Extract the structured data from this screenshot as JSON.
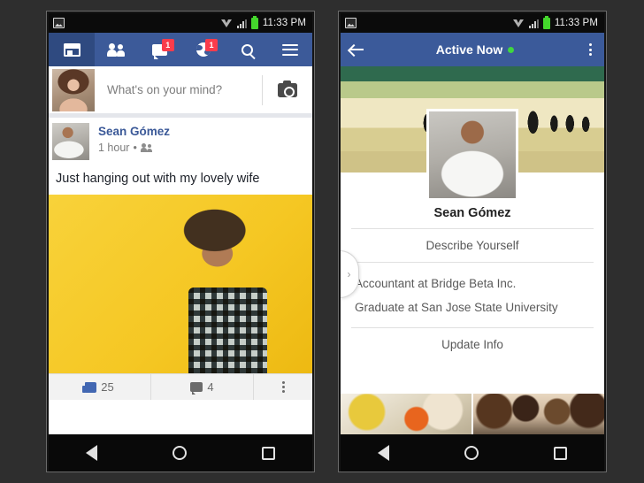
{
  "background_color": "#2e2e2e",
  "phones": {
    "left": {
      "status_bar": {
        "photo_icon": "photo-icon",
        "wifi_icon": "wifi-icon",
        "signal_icon": "signal-icon",
        "battery_icon": "battery-icon",
        "time": "11:33 PM"
      },
      "nav": {
        "accent_color": "#3c5a99",
        "active_color": "#2f4a80",
        "badge_color": "#fa3c4c",
        "tabs": [
          {
            "name": "news-feed",
            "icon": "news-feed-icon",
            "active": true,
            "badge": ""
          },
          {
            "name": "friend-requests",
            "icon": "friends-icon",
            "active": false,
            "badge": ""
          },
          {
            "name": "messages",
            "icon": "message-icon",
            "active": false,
            "badge": "1"
          },
          {
            "name": "notifications",
            "icon": "globe-icon",
            "active": false,
            "badge": "1"
          },
          {
            "name": "search",
            "icon": "search-icon",
            "active": false,
            "badge": ""
          },
          {
            "name": "more-menu",
            "icon": "hamburger-menu-icon",
            "active": false,
            "badge": ""
          }
        ]
      },
      "composer": {
        "avatar_alt": "user-avatar",
        "placeholder": "What's on your mind?",
        "camera_icon": "camera-icon"
      },
      "post": {
        "author": "Sean Gómez",
        "time": "1 hour",
        "separator": "•",
        "audience_icon": "friends-audience-icon",
        "text": "Just hanging out with my lovely wife",
        "photo_alt": "yellow-background-portrait",
        "actions": {
          "like_icon": "thumbs-up-icon",
          "like_count": "25",
          "comment_icon": "comment-icon",
          "comment_count": "4",
          "more_icon": "overflow-menu-icon"
        }
      },
      "soft_nav": {
        "back": "back-nav-icon",
        "home": "home-nav-icon",
        "recents": "recents-nav-icon"
      }
    },
    "right": {
      "status_bar": {
        "photo_icon": "photo-icon",
        "wifi_icon": "wifi-icon",
        "signal_icon": "signal-icon",
        "battery_icon": "battery-icon",
        "time": "11:33 PM"
      },
      "topbar": {
        "accent_color": "#3b5a9a",
        "back_icon": "back-arrow-icon",
        "title": "Active Now",
        "active_dot_color": "#3fd63f",
        "overflow_icon": "overflow-menu-icon"
      },
      "cover_alt": "beach-silhouettes-cover-photo",
      "profile": {
        "picture_alt": "sean-gomez-profile-photo",
        "name": "Sean Gómez",
        "describe_link": "Describe Yourself",
        "bio": [
          "Accountant at Bridge Beta Inc.",
          "Graduate at San Jose State University"
        ],
        "update_link": "Update Info"
      },
      "edge_tab_icon": "chevron-right-icon",
      "photo_strip": [
        {
          "alt": "photo-flowers"
        },
        {
          "alt": "photo-friends"
        }
      ],
      "soft_nav": {
        "back": "back-nav-icon",
        "home": "home-nav-icon",
        "recents": "recents-nav-icon"
      }
    }
  }
}
